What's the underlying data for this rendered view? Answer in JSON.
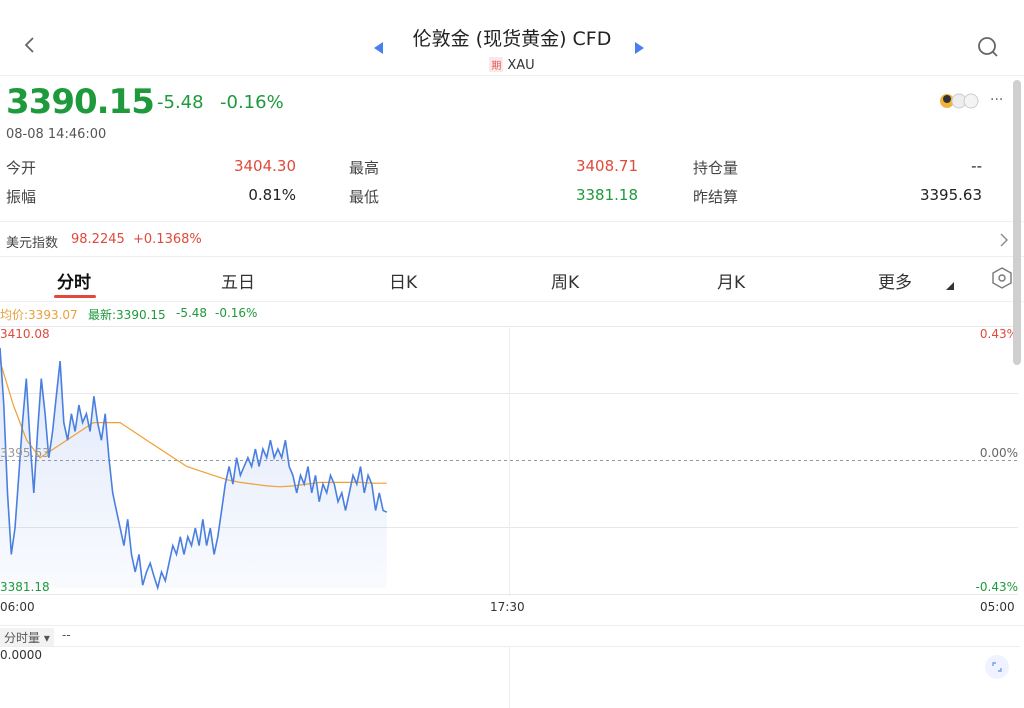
{
  "header": {
    "title": "伦敦金 (现货黄金) CFD",
    "badge": "期",
    "code": "XAU"
  },
  "quote": {
    "price": "3390.15",
    "change": "-5.48",
    "change_pct": "-0.16%",
    "timestamp": "08-08 14:46:00",
    "more": "···",
    "rows": [
      {
        "l1": "今开",
        "v1": "3404.30",
        "l2": "最高",
        "v2": "3408.71",
        "l3": "持仓量",
        "v3": "--"
      },
      {
        "l1": "振幅",
        "v1": "0.81%",
        "l2": "最低",
        "v2": "3381.18",
        "l3": "昨结算",
        "v3": "3395.63"
      }
    ]
  },
  "usd_index": {
    "label": "美元指数",
    "value": "98.2245",
    "change": "+0.1368%"
  },
  "tabs": [
    "分时",
    "五日",
    "日K",
    "周K",
    "月K",
    "更多"
  ],
  "legend": {
    "avg": "均价:3393.07",
    "latest": "最新:3390.15",
    "change": "-5.48",
    "pct": "-0.16%"
  },
  "axis": {
    "y_top": "3410.08",
    "y_mid": "3395.63",
    "y_bot": "3381.18",
    "pct_top": "0.43%",
    "pct_mid": "0.00%",
    "pct_bot": "-0.43%",
    "x_start": "06:00",
    "x_mid": "17:30",
    "x_end": "05:00"
  },
  "volume": {
    "label": "分时量",
    "value": "--",
    "zero": "0.0000"
  },
  "colors": {
    "up": "#e14a3a",
    "down": "#1e9a3c",
    "price_line": "#4a7fe0",
    "avg_line": "#f0a030"
  },
  "chart_data": {
    "type": "line",
    "ylim": [
      3381.18,
      3410.08
    ],
    "series": [
      {
        "values": [
          3408.5,
          3402,
          3392,
          3385,
          3388,
          3394,
          3400,
          3405,
          3398,
          3392,
          3399,
          3405,
          3401,
          3396,
          3399,
          3403,
          3407,
          3400,
          3398,
          3401,
          3399,
          3402,
          3400,
          3401,
          3399,
          3403,
          3400,
          3398,
          3401,
          3396,
          3392,
          3390,
          3388,
          3386,
          3389,
          3385,
          3383,
          3385,
          3381.5,
          3383,
          3384,
          3382.5,
          3381.2,
          3383,
          3382,
          3384,
          3386,
          3385,
          3387,
          3385,
          3387,
          3386,
          3388,
          3386,
          3389,
          3386,
          3388,
          3385,
          3387,
          3390,
          3393,
          3395,
          3393,
          3396,
          3394,
          3395,
          3396,
          3395,
          3397,
          3395,
          3397,
          3396,
          3398,
          3396,
          3397,
          3396,
          3398,
          3395,
          3394,
          3392,
          3394,
          3393,
          3395,
          3392,
          3394,
          3391,
          3393,
          3392,
          3394,
          3393,
          3391,
          3392,
          3390,
          3392,
          3394,
          3393,
          3395,
          3392,
          3394,
          3393,
          3390,
          3392,
          3390,
          3389.8
        ],
        "x_frac_end": 0.38
      },
      {
        "values": [
          3407,
          3402,
          3398,
          3396,
          3397,
          3398,
          3399,
          3400,
          3400,
          3400,
          3399,
          3398,
          3397,
          3396,
          3395,
          3394.5,
          3394,
          3393.5,
          3393.2,
          3393,
          3392.8,
          3392.7,
          3392.8,
          3393,
          3393.2,
          3393.2,
          3393.2,
          3393.2,
          3393.1,
          3393.1
        ],
        "x_frac_end": 0.38
      }
    ]
  }
}
